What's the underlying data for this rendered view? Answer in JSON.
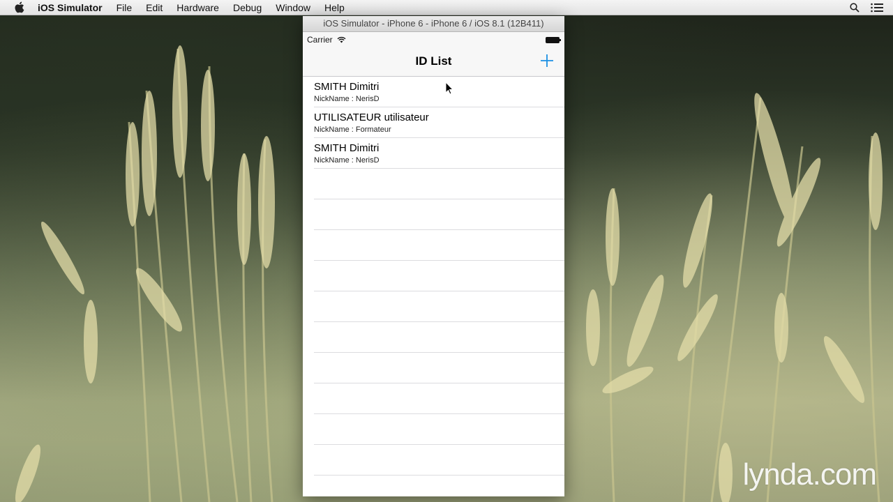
{
  "menubar": {
    "app_name": "iOS Simulator",
    "items": [
      "File",
      "Edit",
      "Hardware",
      "Debug",
      "Window",
      "Help"
    ],
    "icons": [
      "apple-icon",
      "spotlight-search-icon",
      "notification-center-icon"
    ]
  },
  "simulator": {
    "window_title": "iOS Simulator - iPhone 6 - iPhone 6 / iOS 8.1 (12B411)",
    "status_bar": {
      "carrier": "Carrier",
      "icons": [
        "wifi-icon",
        "battery-icon"
      ]
    },
    "nav_bar": {
      "title": "ID List",
      "add_icon": "plus-icon",
      "tint_color": "#007aff"
    },
    "rows": [
      {
        "name": "SMITH Dimitri",
        "detail": "NickName : NerisD"
      },
      {
        "name": "UTILISATEUR utilisateur",
        "detail": "NickName : Formateur"
      },
      {
        "name": "SMITH Dimitri",
        "detail": "NickName : NerisD"
      }
    ]
  },
  "watermark": "lynda.com"
}
